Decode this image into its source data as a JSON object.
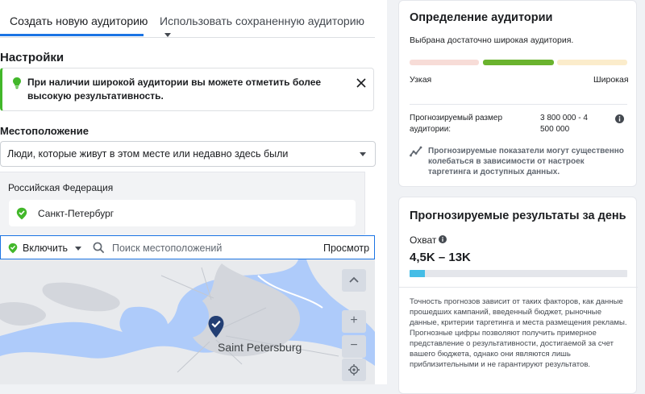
{
  "tabs": {
    "create_new": "Создать новую аудиторию",
    "use_saved": "Использовать сохраненную аудиторию"
  },
  "settings": {
    "title": "Настройки",
    "tip_text": "При наличии широкой аудитории вы можете отметить более высокую результативность."
  },
  "location": {
    "label": "Местоположение",
    "mode": "Люди, которые живут в этом месте или недавно здесь были",
    "country": "Российская Федерация",
    "city": "Санкт-Петербург"
  },
  "map_toolbar": {
    "include_label": "Включить",
    "search_placeholder": "Поиск местоположений",
    "browse_label": "Просмотр"
  },
  "map": {
    "city_label": "Saint Petersburg",
    "zoom_in": "+",
    "zoom_out": "−"
  },
  "audience_definition": {
    "title": "Определение аудитории",
    "status": "Выбрана достаточно широкая аудитория.",
    "narrow_label": "Узкая",
    "broad_label": "Широкая",
    "selected_segment": 2,
    "estimated_size_label": "Прогнозируемый размер аудитории:",
    "estimated_size_value": "3 800 000 - 4 500 000",
    "estimate_note": "Прогнозируемые показатели могут существенно колебаться в зависимости от настроек таргетинга и доступных данных."
  },
  "daily_results": {
    "title": "Прогнозируемые результаты за день",
    "reach_label": "Охват",
    "reach_value": "4,5K – 13K",
    "reach_fill_fraction": 0.07,
    "disclaimer": "Точность прогнозов зависит от таких факторов, как данные прошедших кампаний, введенный бюджет, рыночные данные, критерии таргетинга и места размещения рекламы. Прогнозные цифры позволяют получить примерное представление о результативности, достигаемой за счет вашего бюджета, однако они являются лишь приблизительными и не гарантируют результатов."
  },
  "colors": {
    "accent": "#1b74e4",
    "green": "#42b72a",
    "meter_green": "#6ab32e",
    "reach_bar": "#45bde6"
  }
}
